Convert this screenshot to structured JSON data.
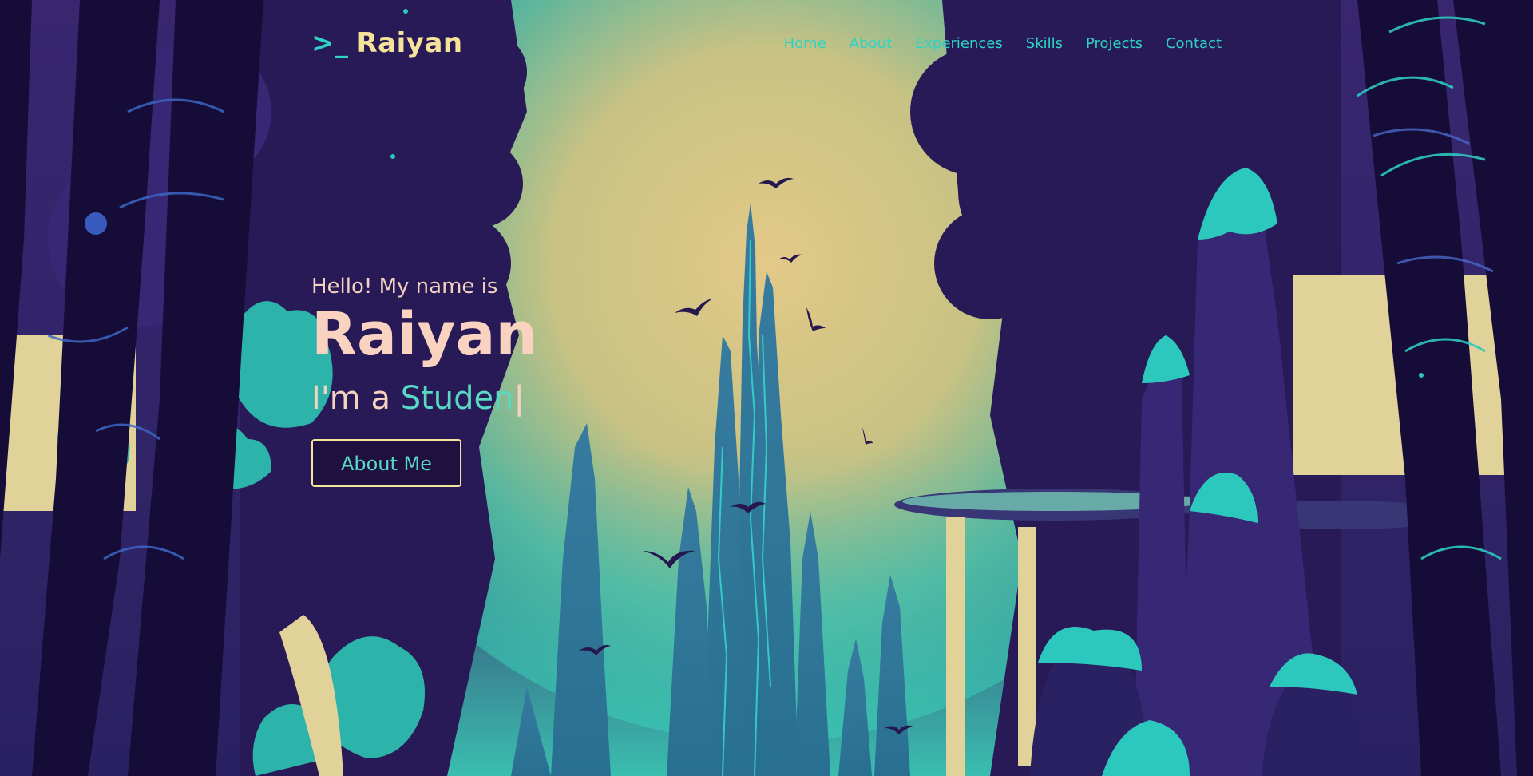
{
  "nav": {
    "logo_prompt": ">_",
    "logo_name": "Raiyan",
    "items": [
      {
        "label": "Home"
      },
      {
        "label": "About"
      },
      {
        "label": "Experiences"
      },
      {
        "label": "Skills"
      },
      {
        "label": "Projects"
      },
      {
        "label": "Contact"
      }
    ]
  },
  "hero": {
    "greeting": "Hello! My name is",
    "name": "Raiyan",
    "role_prefix": "I'm a ",
    "role_typed": "Studen",
    "cursor": "|",
    "cta_label": "About Me"
  },
  "colors": {
    "accent_teal": "#2ed3c3",
    "accent_yellow": "#f6e39a",
    "hero_text": "#fad3c0",
    "night": "#1e1442"
  }
}
